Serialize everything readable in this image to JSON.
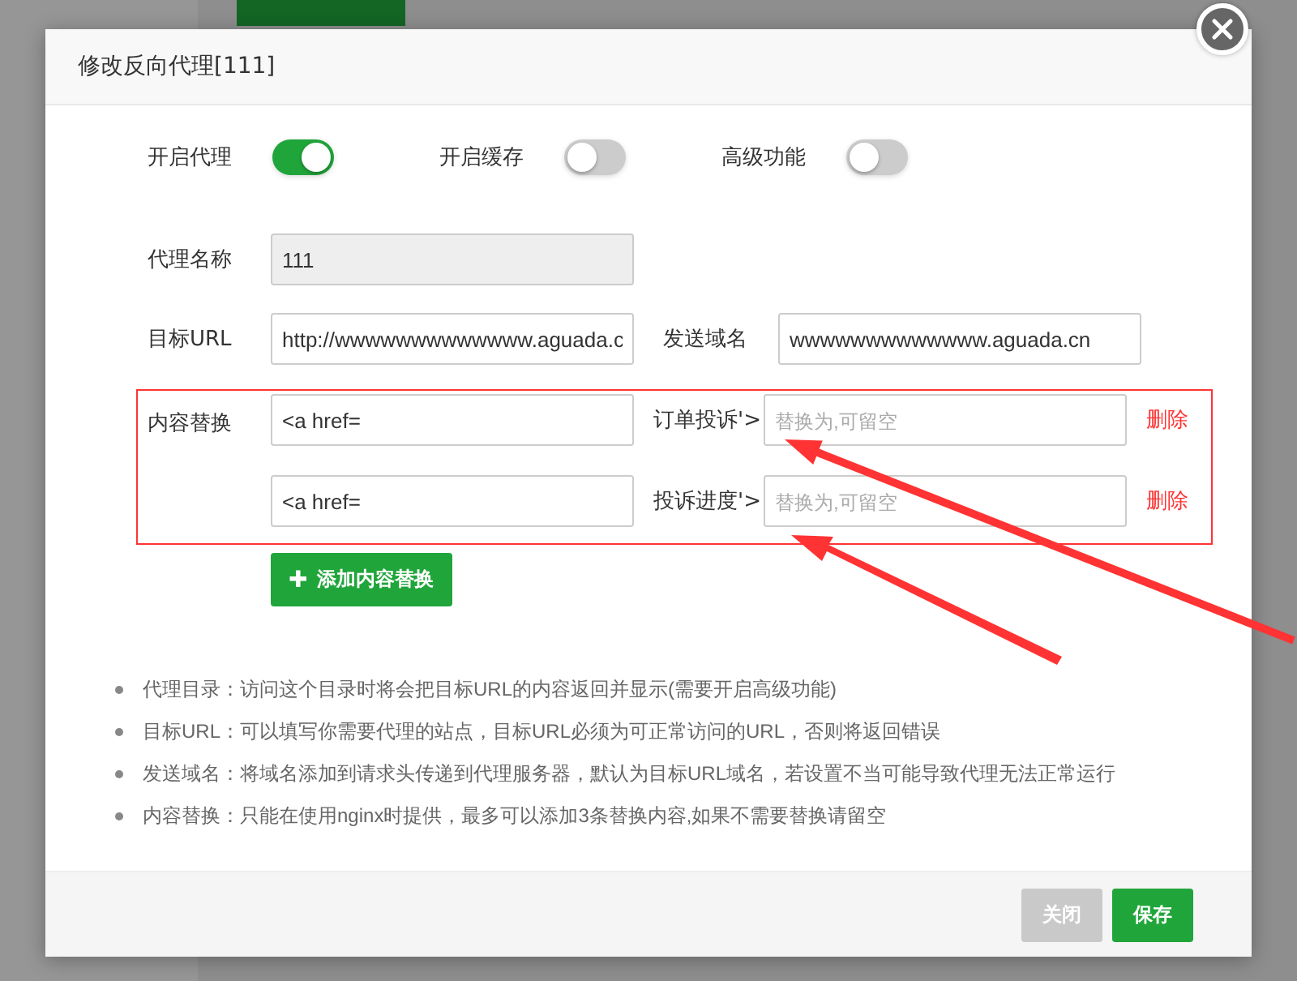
{
  "dialog": {
    "title": "修改反向代理[111]"
  },
  "toggles": [
    {
      "label": "开启代理",
      "on": true
    },
    {
      "label": "开启缓存",
      "on": false
    },
    {
      "label": "高级功能",
      "on": false
    }
  ],
  "name_field": {
    "label": "代理名称",
    "value": "111",
    "disabled": true
  },
  "target_field": {
    "label": "目标URL",
    "value": "http://wwwwwwwwwwwww.aguada.c"
  },
  "host_field": {
    "label": "发送域名",
    "value": "wwwwwwwwwwwww.aguada.cn"
  },
  "replace": {
    "label": "内容替换",
    "rows": [
      {
        "find": "<a href=",
        "suffix": "订单投诉'>",
        "placeholder": "替换为,可留空",
        "delete": "删除"
      },
      {
        "find": "<a href=",
        "suffix": "投诉进度'>",
        "placeholder": "替换为,可留空",
        "delete": "删除"
      }
    ]
  },
  "add_button": {
    "icon": "✚",
    "label": "添加内容替换"
  },
  "notes": [
    "代理目录：访问这个目录时将会把目标URL的内容返回并显示(需要开启高级功能)",
    "目标URL：可以填写你需要代理的站点，目标URL必须为可正常访问的URL，否则将返回错误",
    "发送域名：将域名添加到请求头传递到代理服务器，默认为目标URL域名，若设置不当可能导致代理无法正常运行",
    "内容替换：只能在使用nginx时提供，最多可以添加3条替换内容,如果不需要替换请留空"
  ],
  "buttons": [
    {
      "label": "关闭",
      "kind": "secondary"
    },
    {
      "label": "保存",
      "kind": "primary"
    }
  ]
}
